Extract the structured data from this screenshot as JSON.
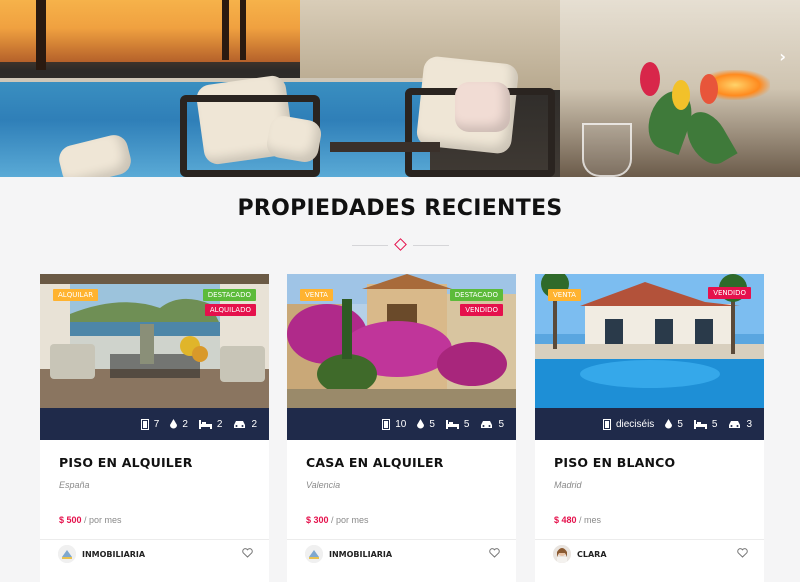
{
  "hero": {
    "next_arrow_icon": "chevron-right-icon"
  },
  "section": {
    "title": "PROPIEDADES RECIENTES"
  },
  "colors": {
    "accent": "#e5114c",
    "navy": "#1f2a4a",
    "status_orange": "#ffb330",
    "featured_green": "#5cbb3a"
  },
  "properties": [
    {
      "status": "ALQUILAR",
      "featured": "DESTACADO",
      "label": "ALQUILADO",
      "features": {
        "rooms": "7",
        "baths": "2",
        "beds": "2",
        "garages": "2"
      },
      "title": "PISO EN ALQUILER",
      "location": "España",
      "price": "$ 500",
      "price_suffix": "/ por mes",
      "agent": "INMOBILIARIA"
    },
    {
      "status": "VENTA",
      "featured": "DESTACADO",
      "label": "VENDIDO",
      "features": {
        "rooms": "10",
        "baths": "5",
        "beds": "5",
        "garages": "5"
      },
      "title": "CASA EN ALQUILER",
      "location": "Valencia",
      "price": "$ 300",
      "price_suffix": "/ por mes",
      "agent": "INMOBILIARIA"
    },
    {
      "status": "VENTA",
      "label": "VENDIDO",
      "features": {
        "rooms": "dieciséis",
        "baths": "5",
        "beds": "5",
        "garages": "3"
      },
      "title": "PISO EN BLANCO",
      "location": "Madrid",
      "price": "$ 480",
      "price_suffix": "/ mes",
      "agent": "CLARA"
    }
  ]
}
